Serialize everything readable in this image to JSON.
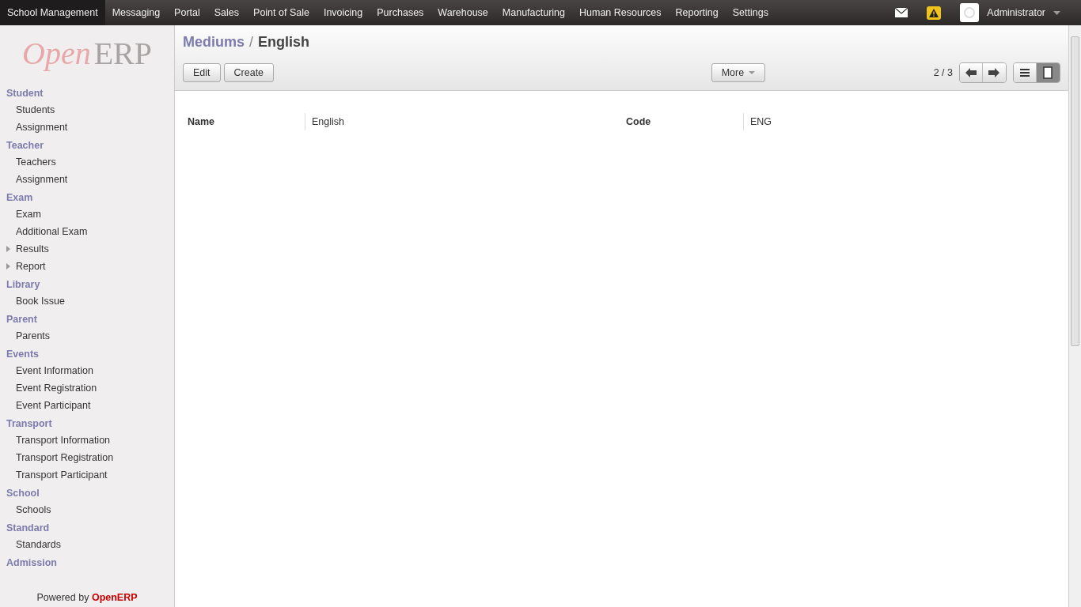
{
  "top_menu": [
    {
      "label": "School Management",
      "selected": true
    },
    {
      "label": "Messaging",
      "selected": false
    },
    {
      "label": "Portal",
      "selected": false
    },
    {
      "label": "Sales",
      "selected": false
    },
    {
      "label": "Point of Sale",
      "selected": false
    },
    {
      "label": "Invoicing",
      "selected": false
    },
    {
      "label": "Purchases",
      "selected": false
    },
    {
      "label": "Warehouse",
      "selected": false
    },
    {
      "label": "Manufacturing",
      "selected": false
    },
    {
      "label": "Human Resources",
      "selected": false
    },
    {
      "label": "Reporting",
      "selected": false
    },
    {
      "label": "Settings",
      "selected": false
    }
  ],
  "user": {
    "name": "Administrator"
  },
  "logo": {
    "part_1": "Open",
    "part_2": "ERP"
  },
  "sidebar": [
    {
      "title": "Student",
      "items": [
        {
          "label": "Students"
        },
        {
          "label": "Assignment"
        }
      ]
    },
    {
      "title": "Teacher",
      "items": [
        {
          "label": "Teachers"
        },
        {
          "label": "Assignment"
        }
      ]
    },
    {
      "title": "Exam",
      "items": [
        {
          "label": "Exam"
        },
        {
          "label": "Additional Exam"
        },
        {
          "label": "Results",
          "expanded": false
        },
        {
          "label": "Report",
          "expanded": false
        }
      ]
    },
    {
      "title": "Library",
      "items": [
        {
          "label": "Book Issue"
        }
      ]
    },
    {
      "title": "Parent",
      "items": [
        {
          "label": "Parents"
        }
      ]
    },
    {
      "title": "Events",
      "items": [
        {
          "label": "Event Information"
        },
        {
          "label": "Event Registration"
        },
        {
          "label": "Event Participant"
        }
      ]
    },
    {
      "title": "Transport",
      "items": [
        {
          "label": "Transport Information"
        },
        {
          "label": "Transport Registration"
        },
        {
          "label": "Transport Participant"
        }
      ]
    },
    {
      "title": "School",
      "items": [
        {
          "label": "Schools"
        }
      ]
    },
    {
      "title": "Standard",
      "items": [
        {
          "label": "Standards"
        }
      ]
    },
    {
      "title": "Admission"
    }
  ],
  "footer": {
    "prefix": "Powered by",
    "brand": "OpenERP"
  },
  "breadcrumb": {
    "parent": "Mediums",
    "separator": "/",
    "current": "English"
  },
  "buttons": [
    "Edit",
    "Create"
  ],
  "more_button": "More",
  "pager": "2 / 3",
  "views": [
    {
      "kind": "list",
      "selected": false
    },
    {
      "kind": "form",
      "selected": true
    }
  ],
  "fields": [
    {
      "label": "Name",
      "value": "English"
    },
    {
      "label": "Code",
      "value": "ENG"
    }
  ]
}
